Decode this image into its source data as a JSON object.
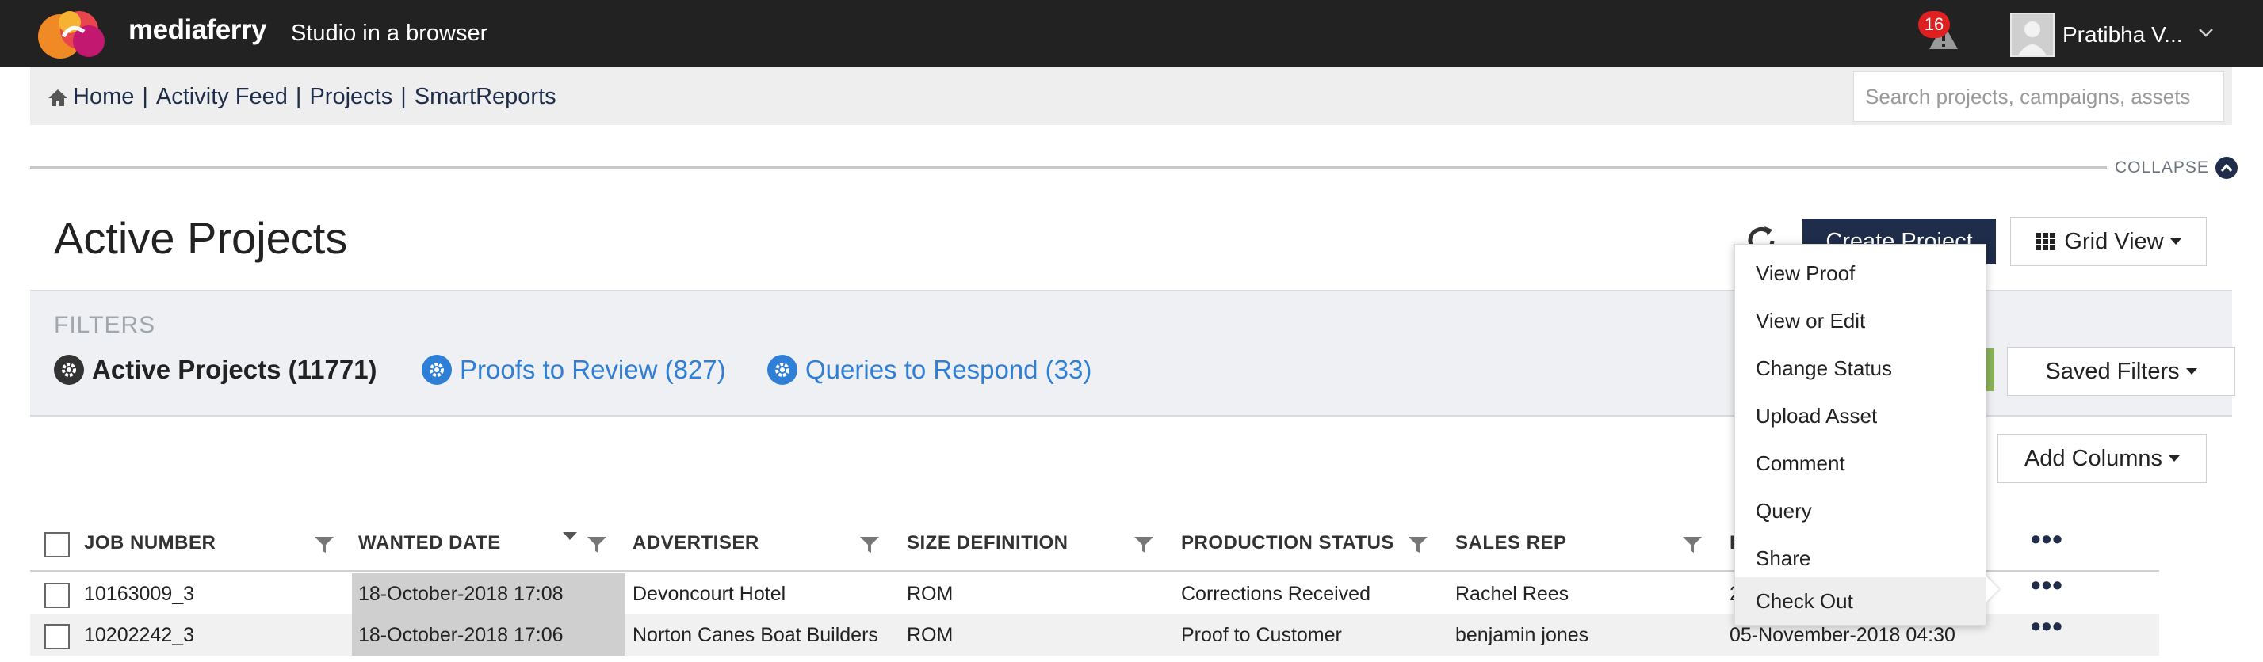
{
  "app": {
    "brand": "mediaferry",
    "tagline": "Studio in a browser",
    "alerts_count": "16",
    "user_name": "Pratibha V..."
  },
  "nav": {
    "home": "Home",
    "items": [
      "Activity Feed",
      "Projects",
      "SmartReports"
    ],
    "separator": "|",
    "search_placeholder": "Search projects, campaigns, assets"
  },
  "collapse_label": "COLLAPSE",
  "page_title": "Active Projects",
  "toolbar": {
    "create_project": "Create Project",
    "grid_view": "Grid View"
  },
  "filters": {
    "label": "FILTERS",
    "active": "Active Projects (11771)",
    "proofs": "Proofs to Review (827)",
    "queries": "Queries to Respond (33)",
    "saved_filters": "Saved Filters"
  },
  "add_columns": "Add Columns",
  "table": {
    "columns": [
      "JOB NUMBER",
      "WANTED DATE",
      "ADVERTISER",
      "SIZE DEFINITION",
      "PRODUCTION STATUS",
      "SALES REP",
      "R"
    ],
    "rows": [
      [
        "10163009_3",
        "18-October-2018 17:08",
        "Devoncourt Hotel",
        "ROM",
        "Corrections Received",
        "Rachel Rees",
        "2"
      ],
      [
        "10202242_3",
        "18-October-2018 17:06",
        "Norton Canes Boat Builders",
        "ROM",
        "Proof to Customer",
        "benjamin jones",
        "05-November-2018 04:30"
      ]
    ],
    "more": "•••"
  },
  "context_menu": {
    "items": [
      "View Proof",
      "View or Edit",
      "Change Status",
      "Upload Asset",
      "Comment",
      "Query",
      "Share",
      "Check Out"
    ],
    "highlighted": "Check Out"
  },
  "colors": {
    "topbar": "#222222",
    "navy": "#1f2d4a",
    "link_blue": "#2f7fd6",
    "badge_red": "#e02020",
    "green_accent": "#8bb35b"
  }
}
